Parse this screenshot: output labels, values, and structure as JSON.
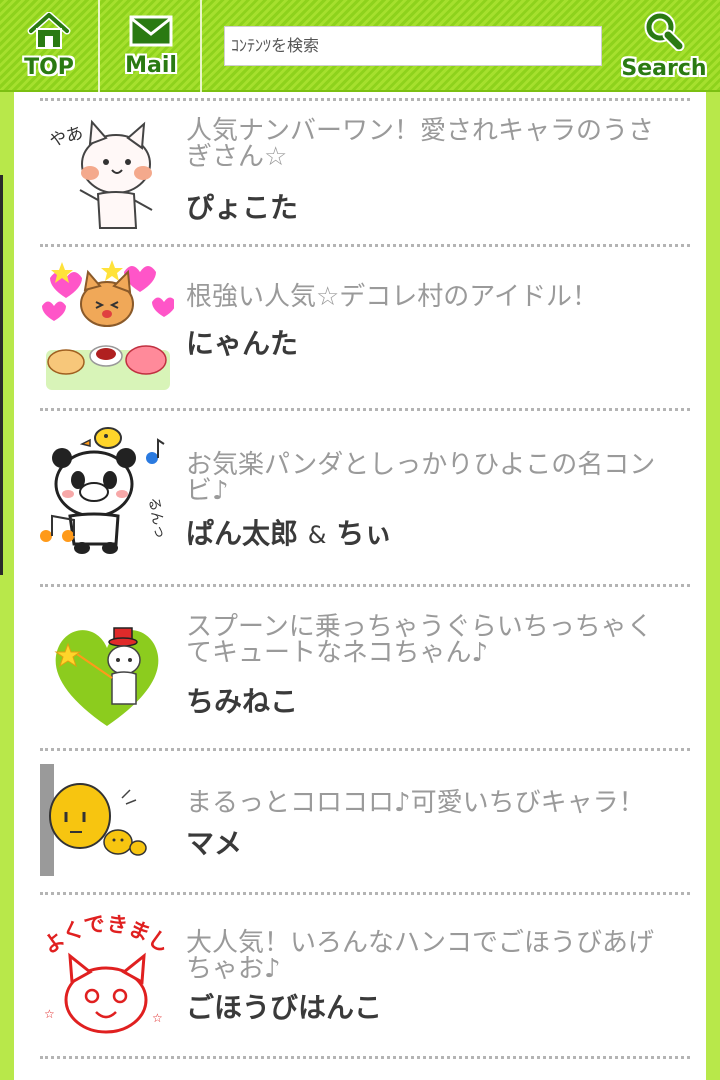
{
  "nav": {
    "top_label": "TOP",
    "mail_label": "Mail",
    "search_label": "Search",
    "search_placeholder": "ｺﾝﾃﾝﾂを検索"
  },
  "items": [
    {
      "desc": "人気ナンバーワン！愛されキャラのうさぎさん☆",
      "name": "ぴょこた",
      "thumb": "rabbit-character-yaa"
    },
    {
      "desc": "根強い人気☆デコレ村のアイドル！",
      "name": "にゃんた",
      "thumb": "cat-with-cakes"
    },
    {
      "desc": "お気楽パンダとしっかりひよこの名コンビ♪",
      "name_a": "ぱん太郎",
      "name_amp": "&",
      "name_b": "ちぃ",
      "thumb": "panda-and-chick"
    },
    {
      "desc": "スプーンに乗っちゃうぐらいちっちゃくてキュートなネコちゃん♪",
      "name": "ちみねこ",
      "thumb": "tiny-cat-heart"
    },
    {
      "desc": "まるっとコロコロ♪可愛いちびキャラ！",
      "name": "マメ",
      "thumb": "bean-characters"
    },
    {
      "desc": "大人気！いろんなハンコでごほうびあげちゃお♪",
      "name": "ごほうびはんこ",
      "thumb": "reward-stamp-cat",
      "stamp_text": "よくできました！"
    }
  ],
  "colors": {
    "header_green": "#8ed21c",
    "frame_green": "#b8e84a",
    "label_green": "#2a7a12",
    "desc_gray": "#9a9a9a",
    "name_dark": "#3a3a3a"
  }
}
